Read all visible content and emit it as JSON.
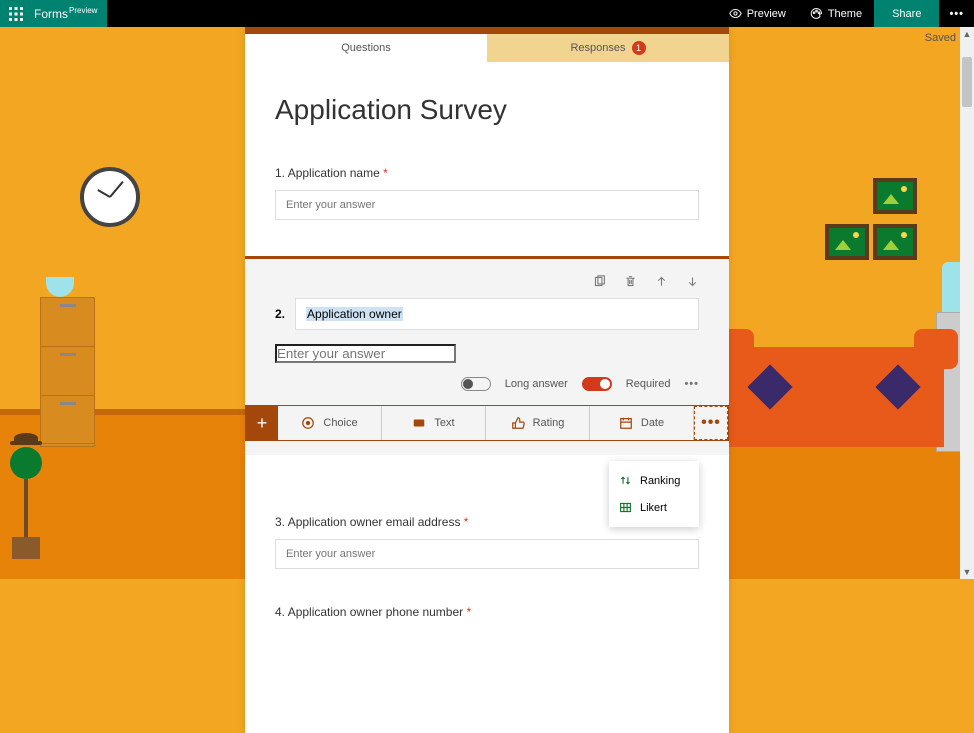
{
  "topbar": {
    "app_name": "Forms",
    "app_badge": "Preview",
    "preview_label": "Preview",
    "theme_label": "Theme",
    "share_label": "Share"
  },
  "status": {
    "saved": "Saved"
  },
  "tabs": {
    "questions": "Questions",
    "responses": "Responses",
    "responses_count": "1"
  },
  "form": {
    "title": "Application Survey",
    "q1": {
      "num": "1.",
      "label": "Application name",
      "placeholder": "Enter your answer"
    },
    "q2": {
      "num": "2.",
      "title": "Application owner",
      "placeholder": "Enter your answer",
      "long_answer_label": "Long answer",
      "required_label": "Required"
    },
    "q3": {
      "num": "3.",
      "label": "Application owner email address",
      "placeholder": "Enter your answer"
    },
    "q4": {
      "num": "4.",
      "label": "Application owner phone number"
    }
  },
  "add": {
    "choice": "Choice",
    "text": "Text",
    "rating": "Rating",
    "date": "Date"
  },
  "more_menu": {
    "ranking": "Ranking",
    "likert": "Likert"
  }
}
